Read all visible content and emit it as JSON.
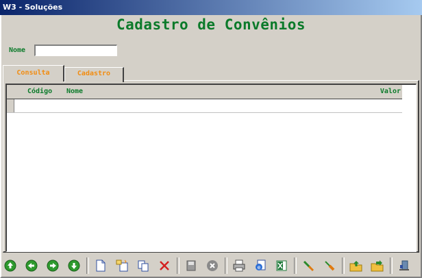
{
  "window": {
    "title": "W3 - Soluções"
  },
  "header": {
    "title": "Cadastro de Convênios"
  },
  "filter": {
    "name_label": "Nome",
    "name_value": ""
  },
  "tabs": [
    {
      "label": "Consulta",
      "active": true
    },
    {
      "label": "Cadastro",
      "active": false
    }
  ],
  "grid": {
    "columns": [
      "Código",
      "Nome",
      "Valor"
    ],
    "rows": []
  },
  "toolbar": {
    "buttons": [
      "up-arrow-icon",
      "left-arrow-icon",
      "right-arrow-icon",
      "down-arrow-icon",
      "new-document-icon",
      "copy-document-icon",
      "duplicate-icon",
      "delete-icon",
      "save-icon",
      "cancel-icon",
      "print-icon",
      "report-icon",
      "excel-icon",
      "tools-icon",
      "brush-icon",
      "export-folder-icon",
      "import-folder-icon",
      "exit-icon"
    ]
  },
  "colors": {
    "accent_green": "#0b7a2a",
    "tab_orange": "#f28c10",
    "window_bg": "#d4d0c8"
  }
}
